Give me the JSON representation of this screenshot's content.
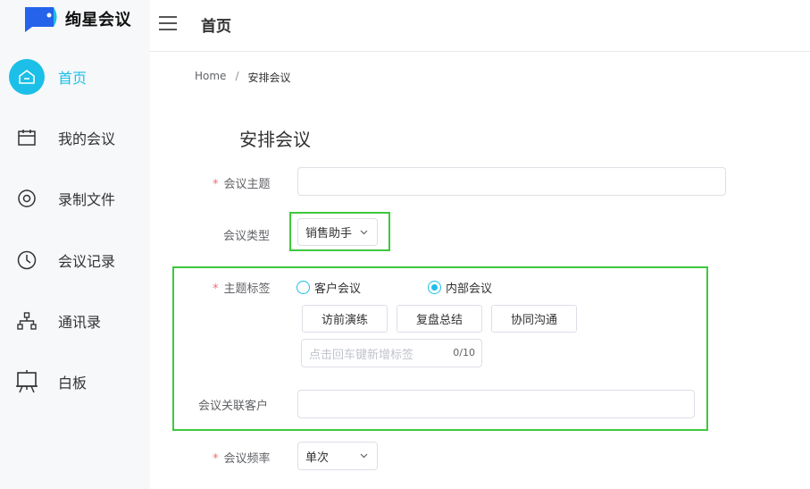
{
  "brand": {
    "name": "绚星会议"
  },
  "sidebar": {
    "items": [
      {
        "label": "首页",
        "icon": "home-icon",
        "active": true
      },
      {
        "label": "我的会议",
        "icon": "calendar-icon",
        "active": false
      },
      {
        "label": "录制文件",
        "icon": "record-icon",
        "active": false
      },
      {
        "label": "会议记录",
        "icon": "clock-icon",
        "active": false
      },
      {
        "label": "通讯录",
        "icon": "org-chart-icon",
        "active": false
      },
      {
        "label": "白板",
        "icon": "whiteboard-icon",
        "active": false
      }
    ]
  },
  "header": {
    "title": "首页"
  },
  "breadcrumb": {
    "home": "Home",
    "separator": "/",
    "current": "安排会议"
  },
  "form": {
    "title": "安排会议",
    "subject": {
      "label": "会议主题",
      "value": "",
      "placeholder": ""
    },
    "type": {
      "label": "会议类型",
      "value": "销售助手"
    },
    "tags": {
      "label": "主题标签",
      "radio_options": [
        {
          "label": "客户会议",
          "checked": false
        },
        {
          "label": "内部会议",
          "checked": true
        }
      ],
      "tag_buttons": [
        "访前演练",
        "复盘总结",
        "协同沟通"
      ],
      "input_placeholder": "点击回车键新增标签",
      "counter": "0/10"
    },
    "customer": {
      "label": "会议关联客户",
      "value": ""
    },
    "frequency": {
      "label": "会议频率",
      "value": "单次"
    }
  },
  "colors": {
    "accent": "#1bbfe7",
    "highlight": "#3ec83e",
    "required": "#f56c6c"
  }
}
